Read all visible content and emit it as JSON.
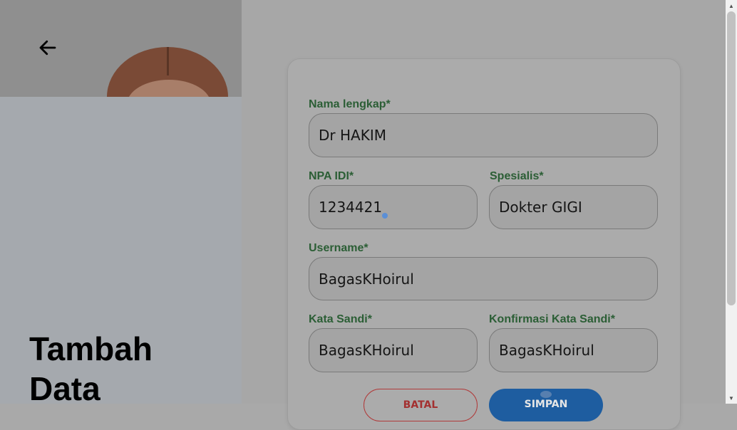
{
  "header": {
    "back_icon": "arrow-left-icon"
  },
  "left_panel": {
    "title_line1": "Tambah",
    "title_line2": "Data"
  },
  "form": {
    "nama_lengkap": {
      "label": "Nama lengkap*",
      "value": "Dr HAKIM"
    },
    "npa_idi": {
      "label": "NPA IDI*",
      "value": "1234421"
    },
    "spesialis": {
      "label": "Spesialis*",
      "value": "Dokter GIGI"
    },
    "username": {
      "label": "Username*",
      "value": "BagasKHoirul"
    },
    "kata_sandi": {
      "label": "Kata Sandi*",
      "value": "BagasKHoirul"
    },
    "konfirmasi_kata_sandi": {
      "label": "Konfirmasi Kata Sandi*",
      "value": "BagasKHoirul"
    },
    "kembali_label": "BATAL",
    "simpan_label": "SIMPAN"
  },
  "colors": {
    "label_green": "#2b5e35",
    "primary_blue": "#1e5da0",
    "cancel_red": "#a33030"
  }
}
